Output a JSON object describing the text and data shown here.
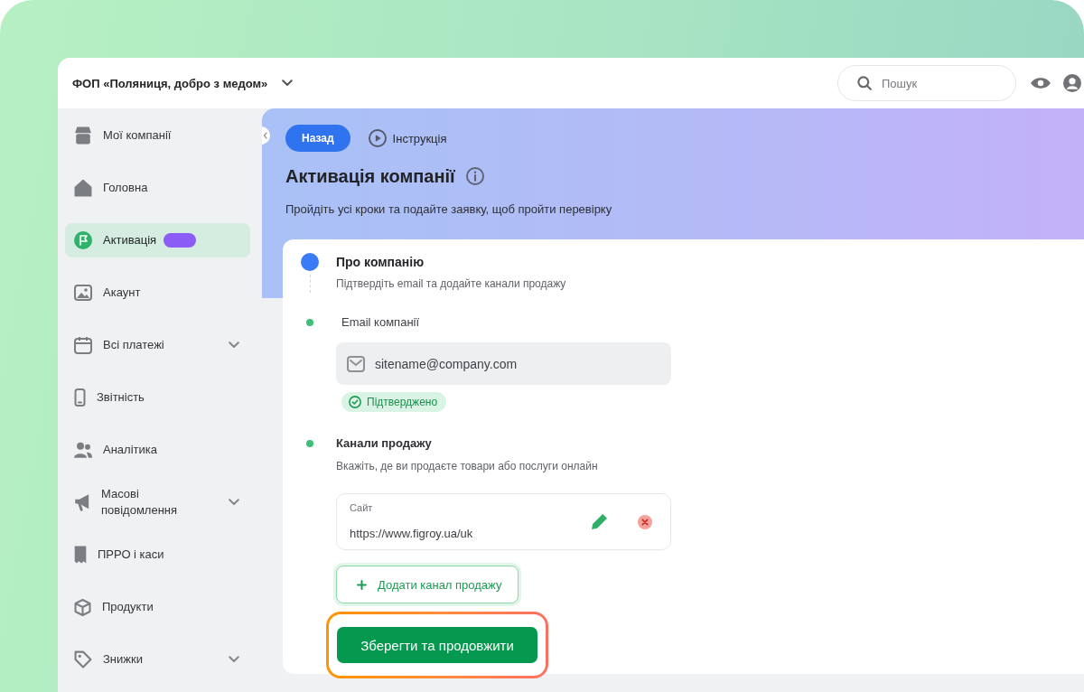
{
  "header": {
    "company": "ФОП «Поляниця, добро з медом»",
    "search": {
      "placeholder": "Пошук"
    }
  },
  "sidebar": {
    "items": [
      {
        "label": "Мої компанії",
        "selected": false,
        "submenu": false,
        "badge": false
      },
      {
        "label": "Головна",
        "selected": false,
        "submenu": false,
        "badge": false
      },
      {
        "label": "Активація",
        "selected": true,
        "submenu": false,
        "badge": true
      },
      {
        "label": "Акаунт",
        "selected": false,
        "submenu": false,
        "badge": false
      },
      {
        "label": "Всі платежі",
        "selected": false,
        "submenu": true,
        "badge": false
      },
      {
        "label": "Звітність",
        "selected": false,
        "submenu": false,
        "badge": false
      },
      {
        "label": "Аналітика",
        "selected": false,
        "submenu": false,
        "badge": false
      },
      {
        "label": "Масові повідомлення",
        "selected": false,
        "submenu": true,
        "badge": false
      },
      {
        "label": "ПРРО і каси",
        "selected": false,
        "submenu": false,
        "badge": false
      },
      {
        "label": "Продукти",
        "selected": false,
        "submenu": false,
        "badge": false
      },
      {
        "label": "Знижки",
        "selected": false,
        "submenu": true,
        "badge": false
      }
    ]
  },
  "page": {
    "back_button": "Назад",
    "guide_link": "Інструкція",
    "title": "Активація компанії",
    "subtitle": "Пройдіть усі кроки та подайте заявку, щоб пройти перевірку"
  },
  "step": {
    "title": "Про компанію",
    "description": "Підтвердіть email та додайте канали продажу",
    "current": true,
    "sections": [
      {
        "kind": "email",
        "label": "Email компанії",
        "done": true,
        "value": "sitename@company.com",
        "status": "Підтверджено"
      },
      {
        "kind": "channels",
        "label": "Канали продажу",
        "done": true,
        "description": "Вкажіть, де ви продаєте товари або послуги онлайн",
        "channels": [
          {
            "channel_label": "Сайт",
            "url": "https://www.figroy.ua/uk"
          }
        ],
        "add_button": "Додати канал продажу"
      }
    ],
    "save_button": {
      "label": "Зберегти та продовжити",
      "highlighted": true
    }
  }
}
